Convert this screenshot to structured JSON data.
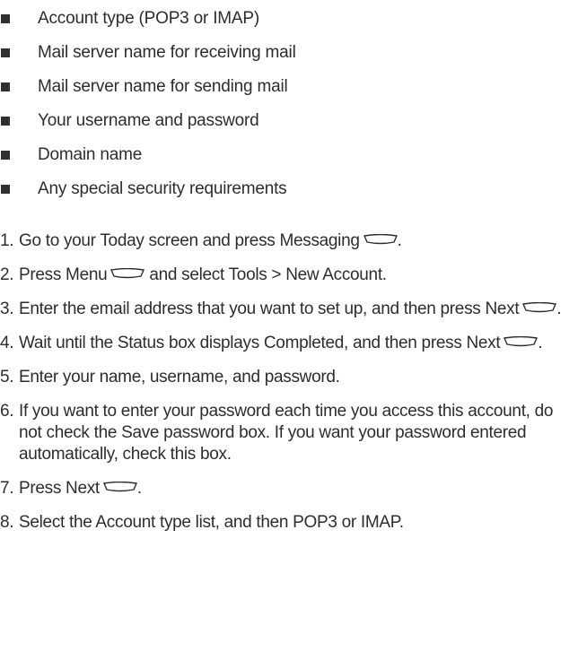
{
  "bullets": [
    "Account type (POP3 or IMAP)",
    "Mail server name for receiving mail",
    "Mail server name for sending mail",
    "Your username and password",
    "Domain name",
    "Any special security requirements"
  ],
  "steps": [
    {
      "num": "1.",
      "before": "Go to your Today screen and press Messaging",
      "after": "."
    },
    {
      "num": "2.",
      "before": "Press Menu",
      "after": " and select Tools > New Account."
    },
    {
      "num": "3.",
      "before": "Enter the email address that you want to set up, and then press Next",
      "after": "."
    },
    {
      "num": "4.",
      "before": "Wait until the Status box displays Completed, and then press Next",
      "after": "."
    },
    {
      "num": "5.",
      "before": "Enter your name, username, and password.",
      "after": ""
    },
    {
      "num": "6.",
      "before": "If you want to enter your password each time you access this account, do not check the Save password box. If you want your password entered automatically, check this box.",
      "after": ""
    },
    {
      "num": "7.",
      "before": "Press Next",
      "after": "."
    },
    {
      "num": "8.",
      "before": "Select the Account type list, and then POP3 or IMAP.",
      "after": ""
    }
  ],
  "icons": {
    "softkey": "softkey-icon",
    "color": "#2d2d2d"
  }
}
